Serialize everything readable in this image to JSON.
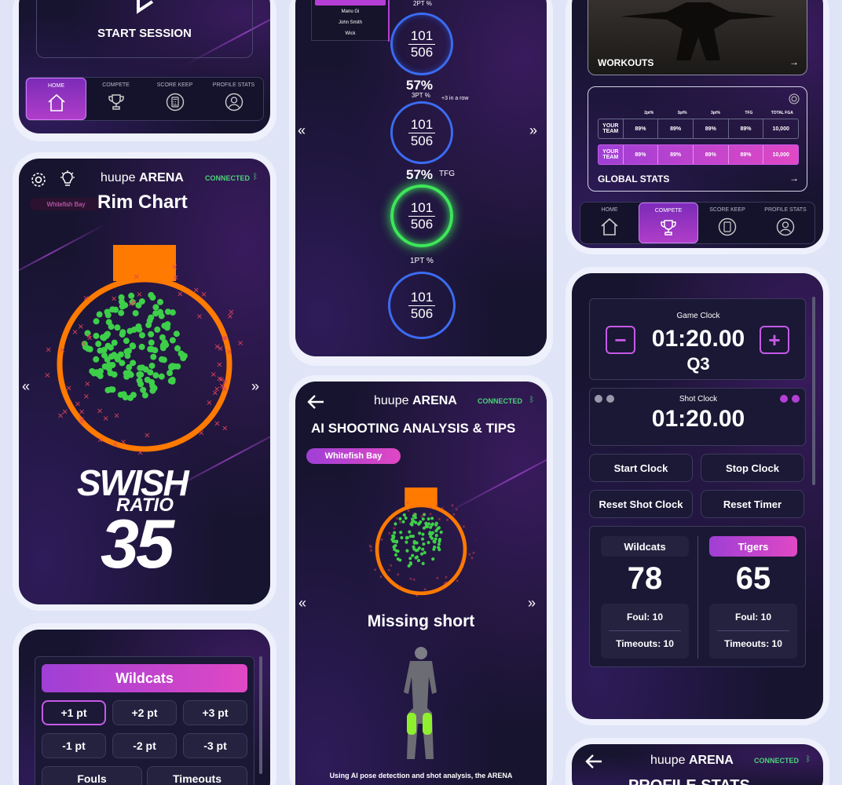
{
  "colors": {
    "accent_purple": "#b53fd6",
    "accent_orange": "#ff7a00",
    "connected_green": "#4bd47a",
    "ring_blue": "#3b6cf2",
    "ring_green": "#3ee65a"
  },
  "phone1": {
    "start_session": "START SESSION",
    "nav": [
      {
        "label": "HOME",
        "icon": "home-icon"
      },
      {
        "label": "COMPETE",
        "icon": "trophy-icon"
      },
      {
        "label": "SCORE KEEP",
        "icon": "calculator-icon"
      },
      {
        "label": "PROFILE STATS",
        "icon": "user-icon"
      }
    ]
  },
  "phone2": {
    "names": [
      "Manu Gi",
      "John Smith",
      "Wick"
    ],
    "rings": [
      {
        "label": "2PT %",
        "num": "101",
        "den": "506"
      },
      {
        "pct": "57%",
        "label": "3PT %",
        "note": "+3 in a row",
        "num": "101",
        "den": "506"
      },
      {
        "pct": "57%",
        "label": "TFG",
        "num": "101",
        "den": "506"
      },
      {
        "label": "1PT %",
        "num": "101",
        "den": "506"
      }
    ]
  },
  "phone3": {
    "workouts": "WORKOUTS",
    "arrow": "→",
    "stats_headers": [
      "2pt%",
      "3pt%",
      "3pt%",
      "TFG",
      "TOTAL FGA"
    ],
    "your_team": {
      "label": "YOUR TEAM",
      "values": [
        "89%",
        "89%",
        "89%",
        "89%",
        "10,000"
      ]
    },
    "global_row": {
      "label": "YOUR TEAM",
      "values": [
        "89%",
        "89%",
        "89%",
        "89%",
        "10,000"
      ]
    },
    "global_stats": "GLOBAL STATS",
    "nav": [
      {
        "label": "HOME",
        "icon": "home-icon"
      },
      {
        "label": "COMPETE",
        "icon": "trophy-icon"
      },
      {
        "label": "SCORE KEEP",
        "icon": "calculator-icon"
      },
      {
        "label": "PROFILE STATS",
        "icon": "user-icon"
      }
    ]
  },
  "phone4": {
    "brand_light": "huupe",
    "brand_bold": "ARENA",
    "connected": "CONNECTED",
    "location": "Whitefish Bay",
    "title": "Rim Chart",
    "swish": "SWISH",
    "ratio": "RATIO",
    "value": "35"
  },
  "phone5": {
    "brand_light": "huupe",
    "brand_bold": "ARENA",
    "connected": "CONNECTED",
    "title": "AI SHOOTING ANALYSIS & TIPS",
    "location": "Whitefish Bay",
    "result": "Missing short",
    "desc": "Using AI pose detection and shot analysis, the ARENA"
  },
  "phone6": {
    "game_clock_label": "Game Clock",
    "game_clock": "01:20.00",
    "quarter": "Q3",
    "minus": "−",
    "plus": "+",
    "shot_clock_label": "Shot Clock",
    "shot_clock": "01:20.00",
    "buttons": [
      "Start Clock",
      "Stop Clock",
      "Reset Shot Clock",
      "Reset Timer"
    ],
    "teams": [
      {
        "name": "Wildcats",
        "score": "78",
        "fouls": "Foul: 10",
        "timeouts": "Timeouts: 10"
      },
      {
        "name": "Tigers",
        "score": "65",
        "fouls": "Foul: 10",
        "timeouts": "Timeouts: 10"
      }
    ]
  },
  "phone7": {
    "team": "Wildcats",
    "buttons": [
      "+1 pt",
      "+2 pt",
      "+3 pt",
      "-1 pt",
      "-2 pt",
      "-3 pt"
    ],
    "fouls": "Fouls",
    "timeouts": "Timeouts"
  },
  "phone8": {
    "brand_light": "huupe",
    "brand_bold": "ARENA",
    "connected": "CONNECTED",
    "title": "PROFILE STATS"
  }
}
